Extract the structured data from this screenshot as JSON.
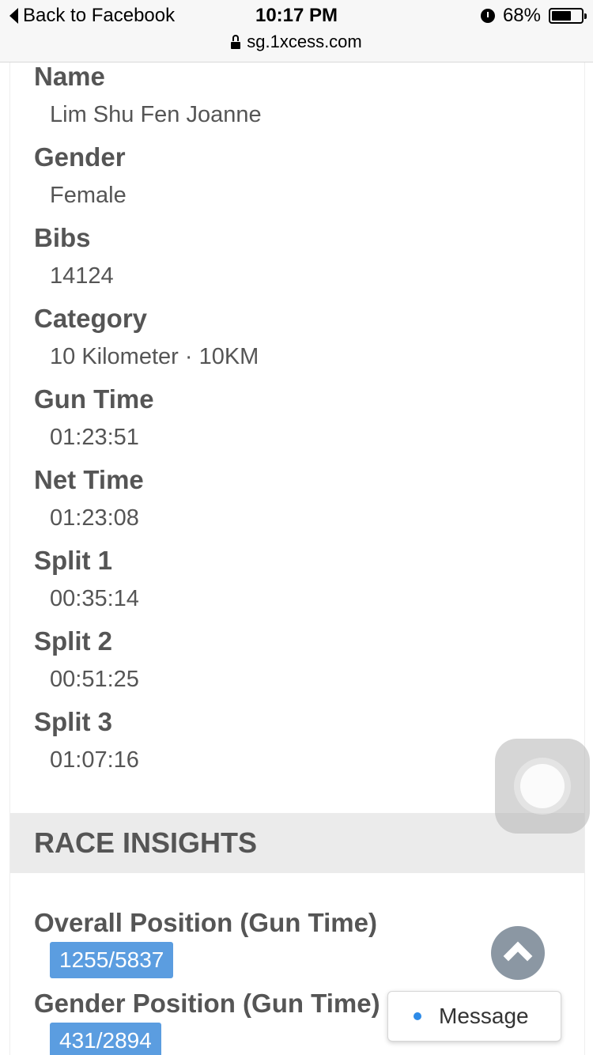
{
  "status_bar": {
    "back_label": "Back to Facebook",
    "time": "10:17 PM",
    "battery_percent": "68%",
    "battery_level": 0.68
  },
  "url_bar": {
    "url": "sg.1xcess.com"
  },
  "details": [
    {
      "label": "Name",
      "value": "Lim Shu Fen Joanne"
    },
    {
      "label": "Gender",
      "value": "Female"
    },
    {
      "label": "Bibs",
      "value": "14124"
    },
    {
      "label": "Category",
      "value": "10 Kilometer · 10KM"
    },
    {
      "label": "Gun Time",
      "value": "01:23:51"
    },
    {
      "label": "Net Time",
      "value": "01:23:08"
    },
    {
      "label": "Split 1",
      "value": "00:35:14"
    },
    {
      "label": "Split 2",
      "value": "00:51:25"
    },
    {
      "label": "Split 3",
      "value": "01:07:16"
    }
  ],
  "insights": {
    "title": "RACE INSIGHTS",
    "positions": [
      {
        "label": "Overall Position (Gun Time)",
        "value": "1255/5837"
      },
      {
        "label": "Gender Position (Gun Time)",
        "value": "431/2894"
      }
    ]
  },
  "message_button": {
    "label": "Message"
  },
  "colors": {
    "badge": "#5b9de0",
    "message_dot": "#2d8be8",
    "scroll_top": "#8b97a3",
    "insights_band": "#ebebeb"
  },
  "icons": [
    "back-arrow-icon",
    "alarm-icon",
    "battery-icon",
    "lock-icon",
    "chevron-up-icon",
    "assistive-touch-icon",
    "dot-icon"
  ]
}
